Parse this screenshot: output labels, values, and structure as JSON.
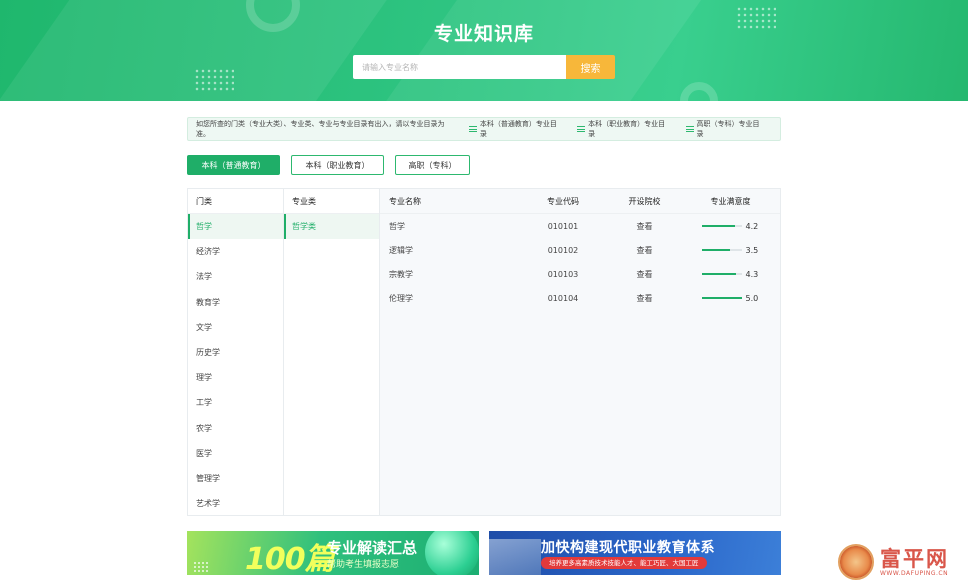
{
  "hero": {
    "title": "专业知识库",
    "search_placeholder": "请输入专业名称",
    "search_button": "搜索"
  },
  "notice": {
    "text": "如您所查的门类（专业大类）、专业类、专业与专业目录有出入，请以专业目录为准。",
    "links": [
      "本科（普通教育）专业目录",
      "本科（职业教育）专业目录",
      "高职（专科）专业目录"
    ]
  },
  "tabs": [
    "本科（普通教育）",
    "本科（职业教育）",
    "高职（专科）"
  ],
  "columns": {
    "category_head": "门类",
    "subcategory_head": "专业类",
    "table_heads": [
      "专业名称",
      "专业代码",
      "开设院校",
      "专业满意度"
    ]
  },
  "categories": [
    "哲学",
    "经济学",
    "法学",
    "教育学",
    "文学",
    "历史学",
    "理学",
    "工学",
    "农学",
    "医学",
    "管理学",
    "艺术学"
  ],
  "subcategories": [
    "哲学类"
  ],
  "majors": [
    {
      "name": "哲学",
      "code": "010101",
      "school": "查看",
      "score": "4.2",
      "level": 0.84
    },
    {
      "name": "逻辑学",
      "code": "010102",
      "school": "查看",
      "score": "3.5",
      "level": 0.7
    },
    {
      "name": "宗教学",
      "code": "010103",
      "school": "查看",
      "score": "4.3",
      "level": 0.86
    },
    {
      "name": "伦理学",
      "code": "010104",
      "school": "查看",
      "score": "5.0",
      "level": 1.0
    }
  ],
  "banner1": {
    "big": "100篇",
    "title": "专业解读汇总",
    "subtitle": "帮助考生填报志愿"
  },
  "banner2": {
    "title": "加快构建现代职业教育体系",
    "subtitle": "培养更多高素质技术技能人才、能工巧匠、大国工匠"
  },
  "watermark": {
    "cn": "富平网",
    "en": "WWW.DAFUPING.CN"
  },
  "colors": {
    "brand": "#1fae68",
    "search_button": "#f7b73a"
  }
}
